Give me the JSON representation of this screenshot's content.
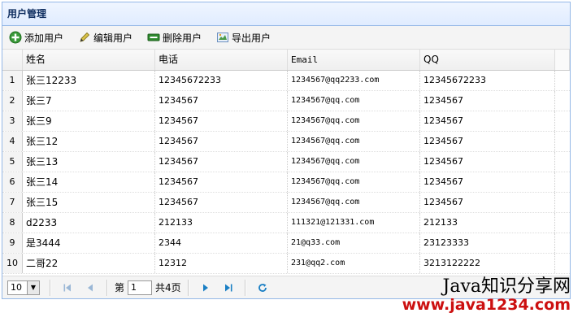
{
  "panel": {
    "title": "用户管理"
  },
  "toolbar": {
    "add_label": "添加用户",
    "edit_label": "编辑用户",
    "remove_label": "删除用户",
    "export_label": "导出用户"
  },
  "grid": {
    "columns": [
      "姓名",
      "电话",
      "Email",
      "QQ"
    ],
    "rows": [
      {
        "num": "1",
        "name": "张三12233",
        "phone": "12345672233",
        "email": "1234567@qq2233.com",
        "qq": "12345672233"
      },
      {
        "num": "2",
        "name": "张三7",
        "phone": "1234567",
        "email": "1234567@qq.com",
        "qq": "1234567"
      },
      {
        "num": "3",
        "name": "张三9",
        "phone": "1234567",
        "email": "1234567@qq.com",
        "qq": "1234567"
      },
      {
        "num": "4",
        "name": "张三12",
        "phone": "1234567",
        "email": "1234567@qq.com",
        "qq": "1234567"
      },
      {
        "num": "5",
        "name": "张三13",
        "phone": "1234567",
        "email": "1234567@qq.com",
        "qq": "1234567"
      },
      {
        "num": "6",
        "name": "张三14",
        "phone": "1234567",
        "email": "1234567@qq.com",
        "qq": "1234567"
      },
      {
        "num": "7",
        "name": "张三15",
        "phone": "1234567",
        "email": "1234567@qq.com",
        "qq": "1234567"
      },
      {
        "num": "8",
        "name": "d2233",
        "phone": "212133",
        "email": "111321@121331.com",
        "qq": "212133"
      },
      {
        "num": "9",
        "name": "是3444",
        "phone": "2344",
        "email": "21@q33.com",
        "qq": "23123333"
      },
      {
        "num": "10",
        "name": "二哥22",
        "phone": "12312",
        "email": "231@qq2.com",
        "qq": "3213122222"
      }
    ]
  },
  "pager": {
    "page_size": "10",
    "page_prefix": "第",
    "page_value": "1",
    "page_suffix": "共4页"
  },
  "watermark": {
    "line1": "Java知识分享网",
    "line2": "www.java1234.com"
  },
  "colors": {
    "border": "#95b8e7",
    "header_text": "#0e2d5f",
    "pager_icon": "#1a7fc4",
    "watermark_red": "#cc1010"
  }
}
